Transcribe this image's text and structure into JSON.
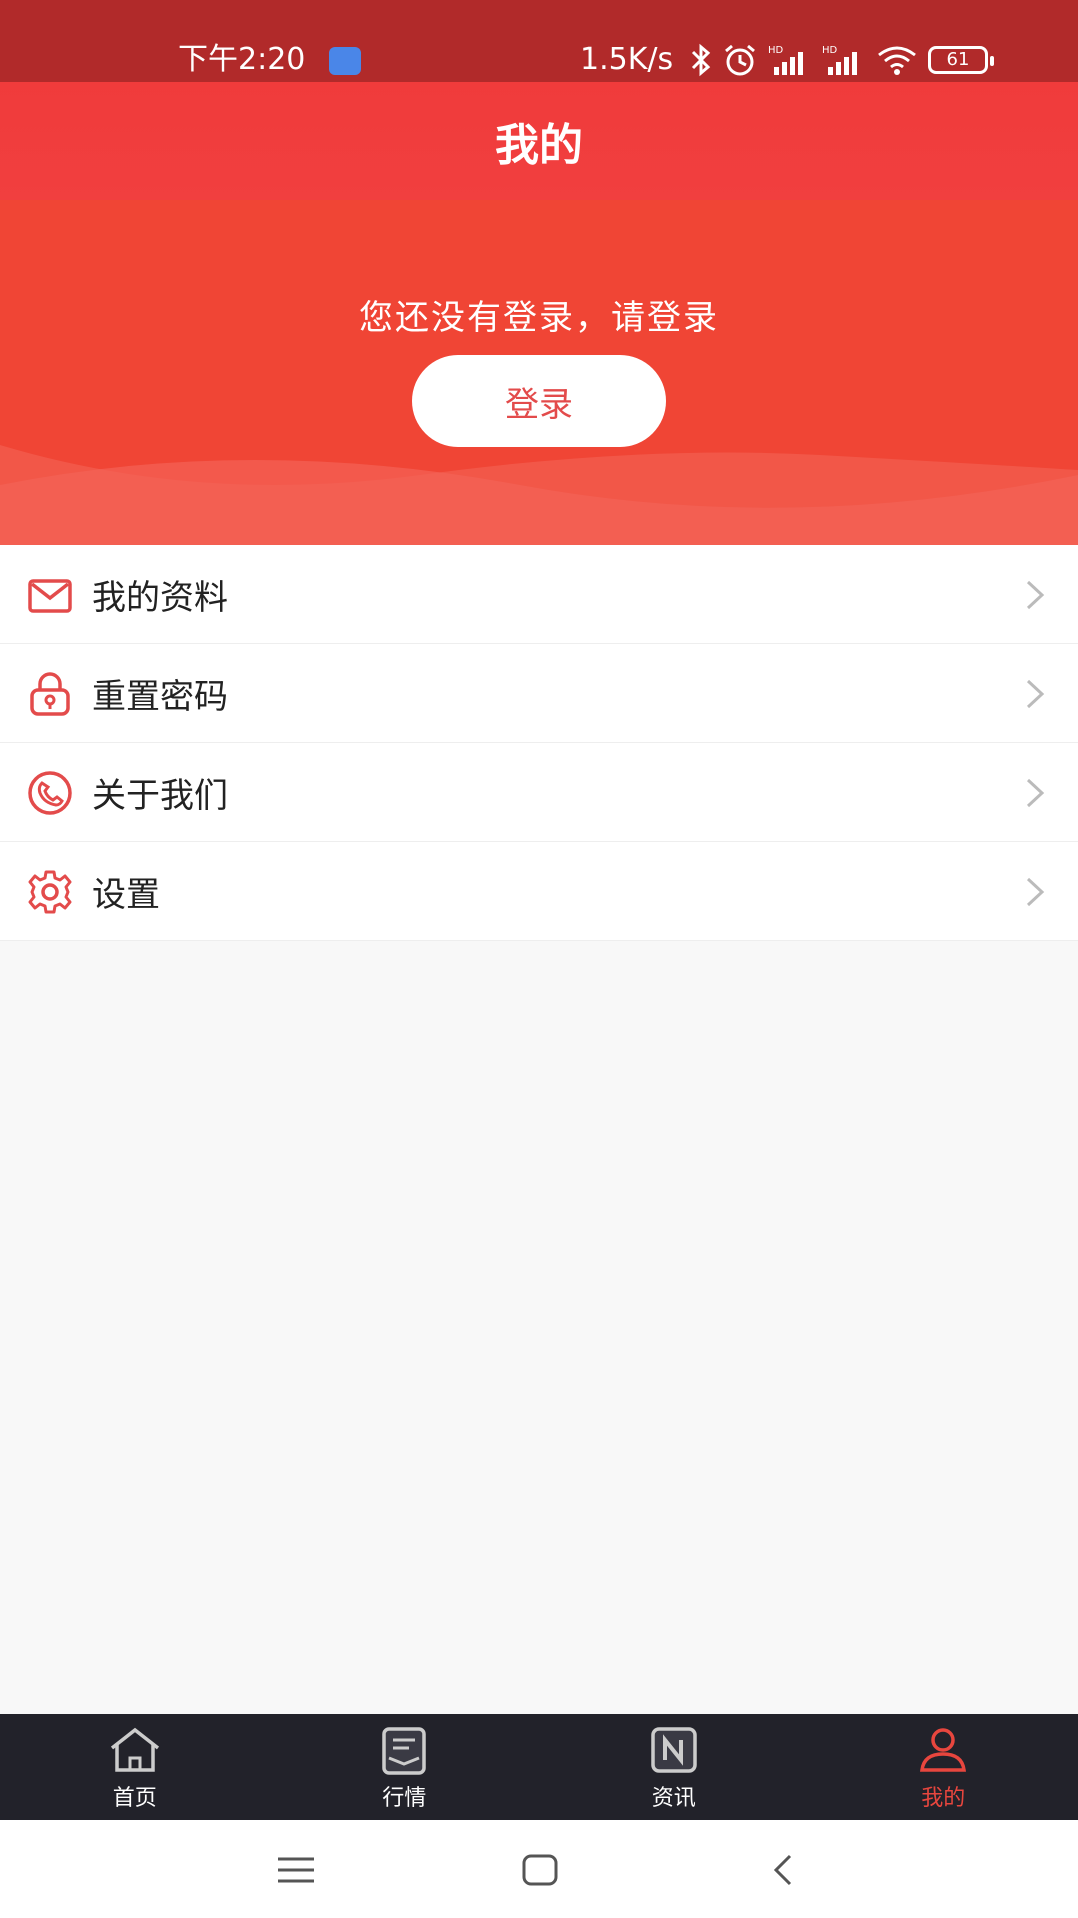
{
  "status_bar": {
    "time": "下午2:20",
    "speed": "1.5K/s",
    "battery": "61",
    "icons": [
      "bluetooth-icon",
      "alarm-icon",
      "signal-icon",
      "signal-icon",
      "wifi-icon",
      "battery-icon"
    ]
  },
  "header": {
    "title": "我的"
  },
  "hero": {
    "prompt": "您还没有登录，请登录",
    "login_label": "登录"
  },
  "menu": {
    "items": [
      {
        "label": "我的资料",
        "icon": "mail-icon"
      },
      {
        "label": "重置密码",
        "icon": "lock-icon"
      },
      {
        "label": "关于我们",
        "icon": "phone-icon"
      },
      {
        "label": "设置",
        "icon": "gear-icon"
      }
    ]
  },
  "bottom_nav": {
    "items": [
      {
        "label": "首页",
        "icon": "home-icon"
      },
      {
        "label": "行情",
        "icon": "market-icon"
      },
      {
        "label": "资讯",
        "icon": "news-icon"
      },
      {
        "label": "我的",
        "icon": "user-icon",
        "active": true
      }
    ]
  },
  "colors": {
    "accent": "#f04535",
    "status_bar": "#b12a2a",
    "nav_bg": "#22222a",
    "active": "#e8463e"
  }
}
